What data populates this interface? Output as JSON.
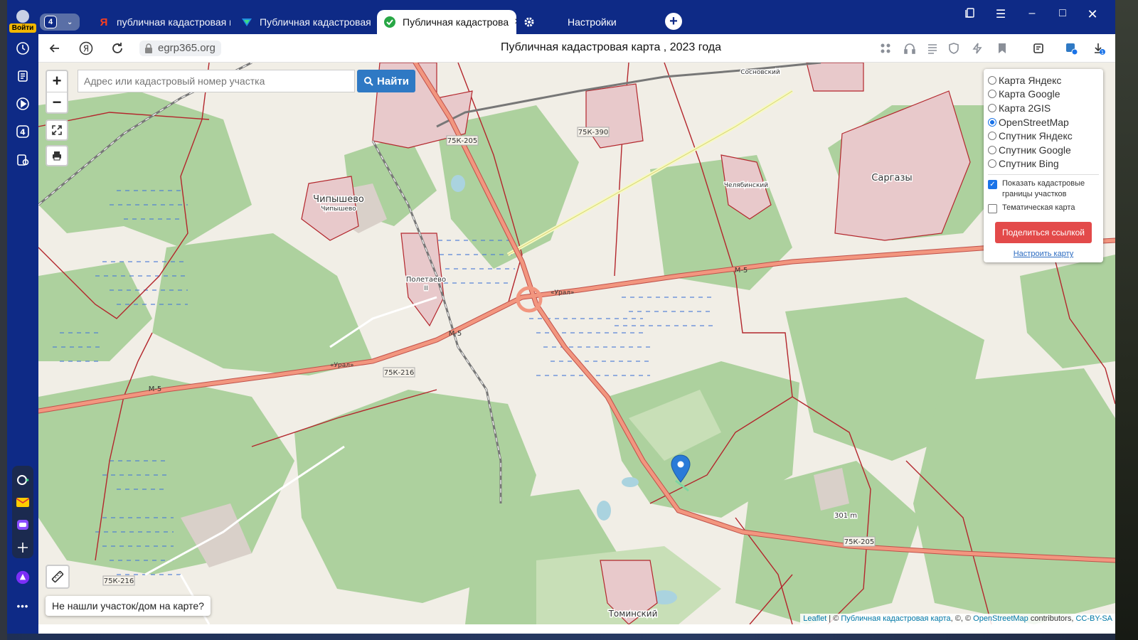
{
  "sidebar": {
    "login_label": "Войти",
    "items": [
      "history-icon",
      "collections-icon",
      "play-icon",
      "tabs-icon",
      "screenshot-icon"
    ],
    "tabs_count": "4",
    "more": "•••"
  },
  "tabs": {
    "count": "4",
    "items": [
      {
        "label": "публичная кадастровая к",
        "icon": "yandex-icon",
        "icon_color": "#fc3f1d",
        "active": false
      },
      {
        "label": "Публичная кадастровая к",
        "icon": "rosreestr-icon",
        "icon_color": "#1e90e0",
        "active": false
      },
      {
        "label": "Публичная кадастрова",
        "icon": "check-icon",
        "icon_color": "#28a745",
        "active": true
      },
      {
        "label": "Настройки",
        "icon": "gear-icon",
        "icon_color": "#ffffff",
        "active": false
      }
    ],
    "new_tab": "+"
  },
  "address_bar": {
    "url": "egrp365.org",
    "page_title": "Публичная кадастровая карта , 2023 года",
    "downloads_badge": "1"
  },
  "map": {
    "search_placeholder": "Адрес или кадастровый номер участка",
    "find_button": "Найти",
    "zoom_in": "+",
    "zoom_out": "−",
    "layers": {
      "options": [
        {
          "label": "Карта Яндекс",
          "selected": false
        },
        {
          "label": "Карта Google",
          "selected": false
        },
        {
          "label": "Карта 2GIS",
          "selected": false
        },
        {
          "label": "OpenStreetMap",
          "selected": true
        },
        {
          "label": "Спутник Яндекс",
          "selected": false
        },
        {
          "label": "Спутник Google",
          "selected": false
        },
        {
          "label": "Спутник Bing",
          "selected": false
        }
      ],
      "show_cadastral": "Показать кадастровые границы участков",
      "show_cadastral_checked": true,
      "thematic": "Тематическая карта",
      "thematic_checked": false,
      "share_button": "Поделиться ссылкой",
      "configure_link": "Настроить карту"
    },
    "not_found": "Не нашли участок/дом на карте?",
    "attribution": {
      "leaflet": "Leaflet",
      "sep1": " | © ",
      "pkk": "Публичная кадастровая карта",
      "sep2": ", ©, © ",
      "osm": "OpenStreetMap",
      "sep3": " contributors, ",
      "license": "CC-BY-SA"
    },
    "labels": {
      "road_75k205_a": "75К-205",
      "road_75k205_b": "75К-205",
      "road_75k390": "75К-390",
      "road_75k216_a": "75К-216",
      "road_75k216_b": "75К-216",
      "m5_a": "М-5",
      "m5_b": "М-5",
      "m5_c": "М-5",
      "ural": "«Урал»",
      "place_chipyshevo": "Чипышево",
      "place_chipyshevo_small": "Чипышево",
      "place_poletaevo": "Полетаево",
      "place_poletaevo_small": "II",
      "place_sargazy": "Саргазы",
      "place_tominsky": "Томинский",
      "place_chelyabinsk": "Челябинский",
      "place_sosnovsky": "Сосновский",
      "height": "301 m"
    }
  },
  "colors": {
    "browser_blue": "#0e2a86",
    "find_blue": "#2f79c4",
    "share_red": "#e34a4a",
    "cadastral_red": "#b3262c",
    "road_orange": "#e8826a",
    "forest_green": "#add19e"
  }
}
